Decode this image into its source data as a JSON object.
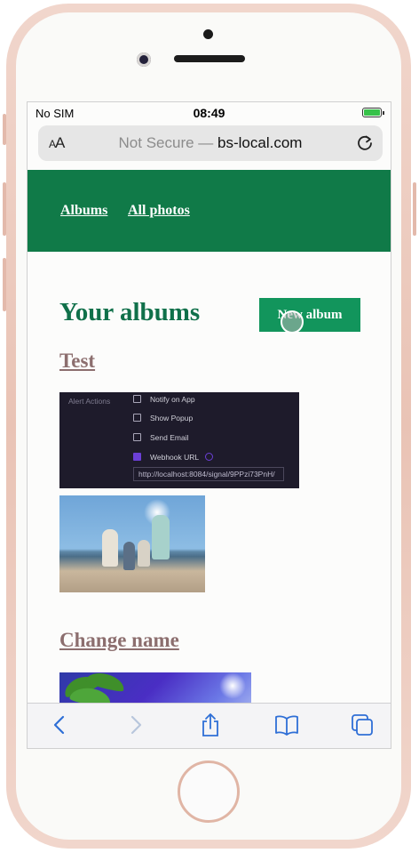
{
  "status_bar": {
    "carrier": "No SIM",
    "time": "08:49",
    "battery_level": 1.0,
    "battery_color": "#37c24a"
  },
  "address_bar": {
    "aa_label_small": "A",
    "aa_label_large": "A",
    "security_text": "Not Secure —",
    "domain": "bs-local.com",
    "reload_icon": "reload-icon"
  },
  "site_nav": {
    "background": "#107a48",
    "links": [
      "Albums",
      "All photos"
    ]
  },
  "page": {
    "title": "Your albums",
    "new_album_label": "New album",
    "accent": "#12955c"
  },
  "albums": [
    {
      "title": "Test",
      "screenshot": {
        "section_label": "Alert Actions",
        "options": [
          {
            "label": "Notify on App",
            "checked": false
          },
          {
            "label": "Show Popup",
            "checked": false
          },
          {
            "label": "Send Email",
            "checked": false
          },
          {
            "label": "Webhook URL",
            "checked": true
          }
        ],
        "webhook_url": "http://localhost:8084/signal/9PPzi73PnH/"
      }
    },
    {
      "title": "Change name"
    }
  ],
  "toolbar": {
    "icons": [
      "back-icon",
      "forward-icon",
      "share-icon",
      "bookmarks-icon",
      "tabs-icon"
    ],
    "tint": "#2f6fd6"
  }
}
